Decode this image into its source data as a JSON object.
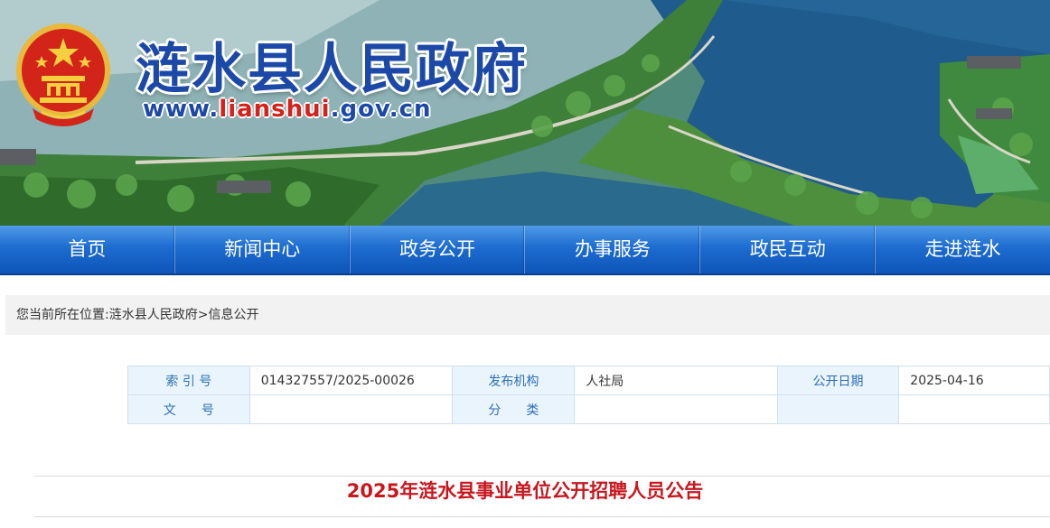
{
  "header": {
    "site_title": "涟水县人民政府",
    "url_prefix": "www.",
    "url_domain": "lianshui",
    "url_suffix": ".gov.cn",
    "emblem_icon": "national-emblem-icon"
  },
  "nav": {
    "items": [
      {
        "label": "首页"
      },
      {
        "label": "新闻中心"
      },
      {
        "label": "政务公开"
      },
      {
        "label": "办事服务"
      },
      {
        "label": "政民互动"
      },
      {
        "label": "走进涟水"
      }
    ]
  },
  "breadcrumb": {
    "prefix": "您当前所在位置:",
    "items": [
      "涟水县人民政府",
      "信息公开"
    ],
    "separator": ">"
  },
  "info_table": {
    "index_label": "索 引 号",
    "index_value": "014327557/2025-00026",
    "publisher_label": "发布机构",
    "publisher_value": "人社局",
    "date_label": "公开日期",
    "date_value": "2025-04-16",
    "doc_no_label": "文　　号",
    "doc_no_value": "",
    "category_label": "分　　类",
    "category_value": ""
  },
  "article": {
    "title": "2025年涟水县事业单位公开招聘人员公告"
  },
  "colors": {
    "nav_blue": "#1d6cd0",
    "title_blue": "#1c49a8",
    "article_red": "#c8161d",
    "label_bg": "#eaf4fd",
    "label_text": "#2c6fb7"
  }
}
